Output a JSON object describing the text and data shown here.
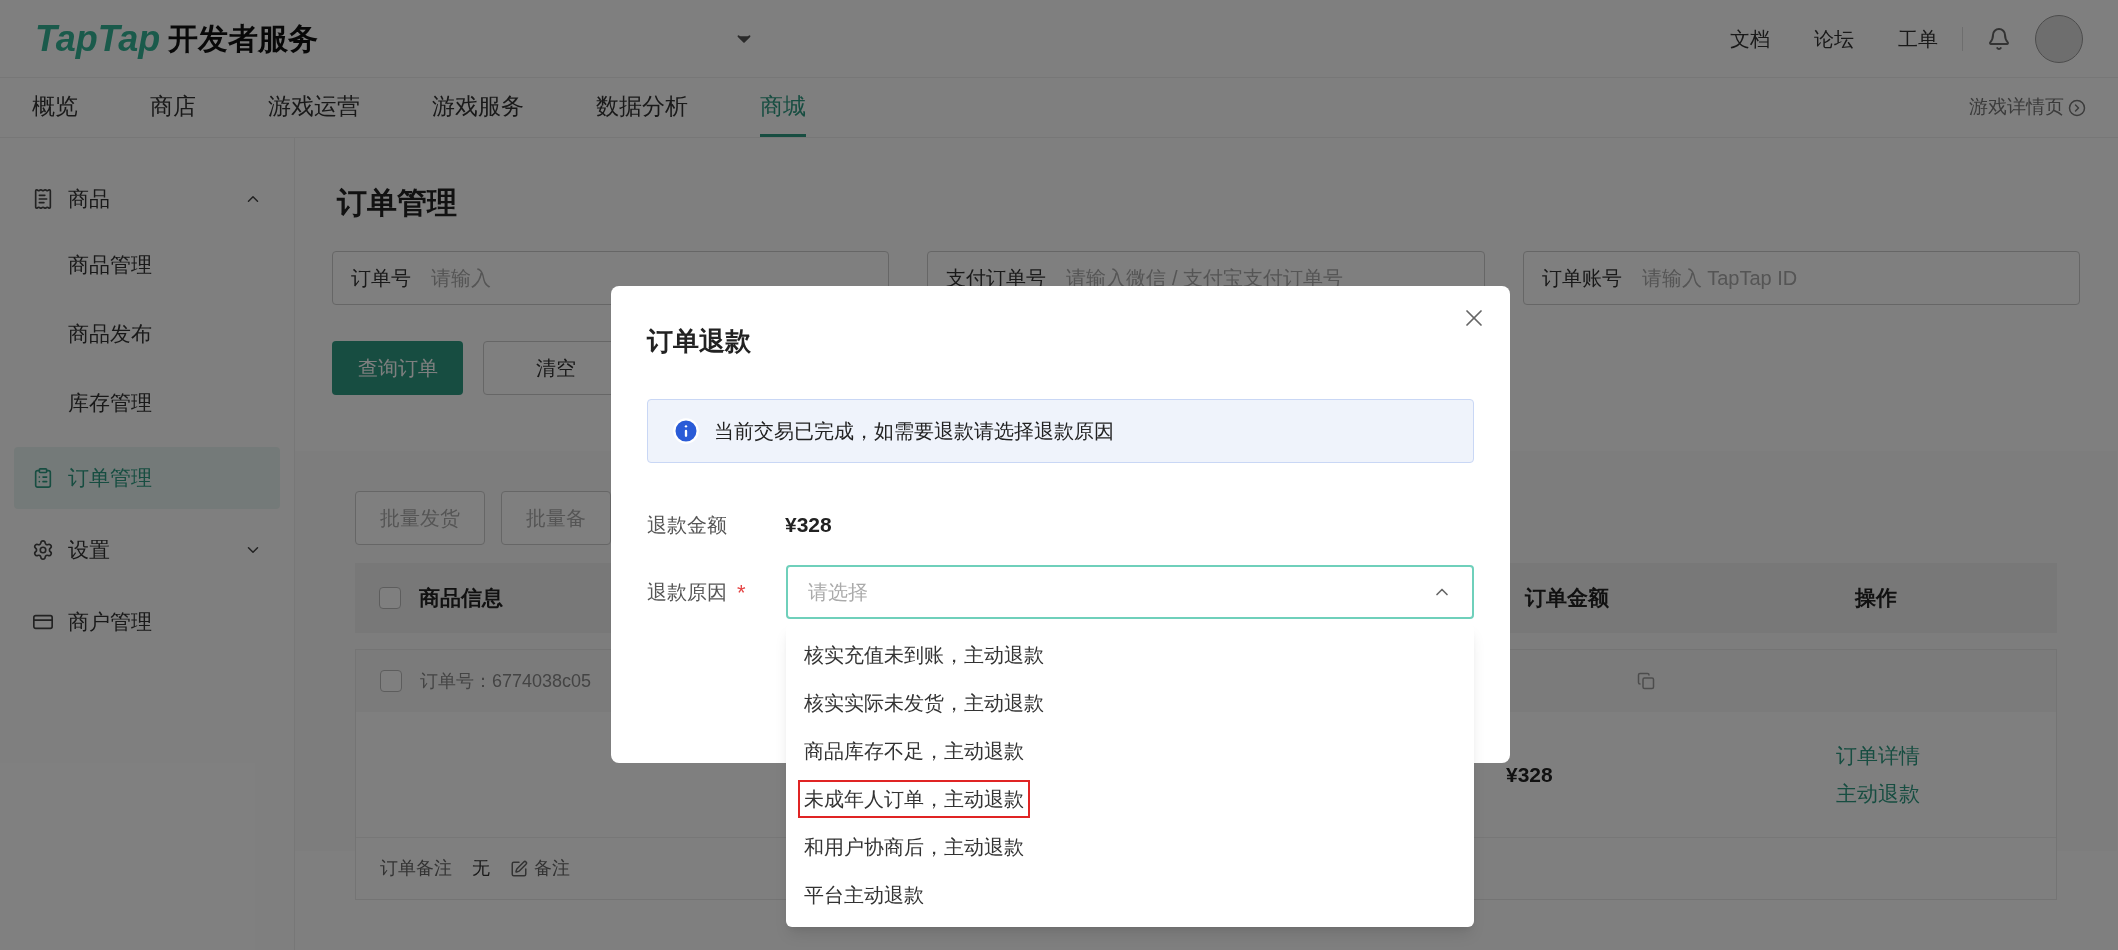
{
  "header": {
    "logo_brand": "TapTap",
    "logo_text": "开发者服务",
    "links": [
      "文档",
      "论坛",
      "工单"
    ]
  },
  "nav": {
    "tabs": [
      {
        "label": "概览",
        "selected": false
      },
      {
        "label": "商店",
        "selected": false
      },
      {
        "label": "游戏运营",
        "selected": false
      },
      {
        "label": "游戏服务",
        "selected": false
      },
      {
        "label": "数据分析",
        "selected": false
      },
      {
        "label": "商城",
        "selected": true
      }
    ],
    "game_detail_link": "游戏详情页"
  },
  "sidebar": {
    "items": [
      {
        "label": "商品",
        "selected": false,
        "expanded": true,
        "children": [
          {
            "label": "商品管理",
            "selected": false
          },
          {
            "label": "商品发布",
            "selected": false
          },
          {
            "label": "库存管理",
            "selected": false
          }
        ]
      },
      {
        "label": "订单管理",
        "selected": true
      },
      {
        "label": "设置",
        "selected": false,
        "expanded": false
      },
      {
        "label": "商户管理",
        "selected": false
      }
    ]
  },
  "page": {
    "title": "订单管理",
    "filters": [
      {
        "label": "订单号",
        "placeholder": "请输入"
      },
      {
        "label": "支付订单号",
        "placeholder": "请输入微信 / 支付宝支付订单号"
      },
      {
        "label": "订单账号",
        "placeholder": "请输入 TapTap ID"
      }
    ],
    "buttons": [
      {
        "label": "查询订单",
        "kind": "primary"
      },
      {
        "label": "清空",
        "kind": "default"
      }
    ]
  },
  "table": {
    "batch_buttons": [
      "批量发货",
      "批量备"
    ],
    "header_checked": false,
    "columns": [
      "商品信息",
      "订单金额",
      "操作"
    ],
    "order": {
      "checked": false,
      "order_no": "订单号：6774038c05",
      "amount": "¥328",
      "actions": [
        "订单详情",
        "主动退款"
      ],
      "note_label": "订单备注",
      "note_value": "无",
      "note_action": "备注"
    }
  },
  "modal": {
    "title": "订单退款",
    "alert": "当前交易已完成，如需要退款请选择退款原因",
    "amount_label": "退款金额",
    "amount": "¥328",
    "reason_label": "退款原因",
    "reason_required": "*",
    "reason_placeholder": "请选择",
    "reason_expanded": true,
    "options": [
      {
        "label": "核实充值未到账，主动退款",
        "highlighted": false
      },
      {
        "label": "核实实际未发货，主动退款",
        "highlighted": false
      },
      {
        "label": "商品库存不足，主动退款",
        "highlighted": false
      },
      {
        "label": "未成年人订单，主动退款",
        "highlighted": true
      },
      {
        "label": "和用户协商后，主动退款",
        "highlighted": false
      },
      {
        "label": "平台主动退款",
        "highlighted": false
      }
    ]
  }
}
